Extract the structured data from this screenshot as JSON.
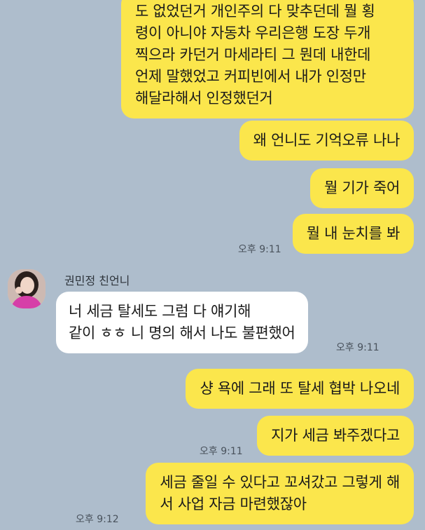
{
  "contact": {
    "name": "권민정 친언니"
  },
  "messages": [
    {
      "side": "out",
      "text": "도 없었던거 개인주의 다 맞추던데 뭘 횡\n령이 아니야 자동차 우리은행 도장 두개\n찍으라 카던거 마세라티 그 뭔데 내한데\n언제 말했었고 커피빈에서 내가 인정만\n해달라해서 인정했던거"
    },
    {
      "side": "out",
      "text": "왜 언니도 기억오류 나나"
    },
    {
      "side": "out",
      "text": "뭘 기가 죽어"
    },
    {
      "side": "out",
      "text": "뭘 내 눈치를 봐",
      "time": "오후 9:11"
    },
    {
      "side": "in",
      "text": "너 세금 탈세도 그럼 다 얘기해\n같이 ㅎㅎ 니 명의 해서 나도 불편했어",
      "time": "오후 9:11"
    },
    {
      "side": "out",
      "text": "샹 욕에 그래 또 탈세 협박 나오네"
    },
    {
      "side": "out",
      "text": "지가 세금 봐주겠다고",
      "time": "오후 9:11"
    },
    {
      "side": "out",
      "text": "세금 줄일 수 있다고 꼬셔갔고 그렇게 해\n서 사업 자금 마련했잖아",
      "time": "오후 9:12"
    }
  ],
  "colors": {
    "background": "#aebdcc",
    "outgoing_bubble": "#fbe64c",
    "incoming_bubble": "#ffffff"
  },
  "icons": {
    "avatar": "profile-photo"
  }
}
